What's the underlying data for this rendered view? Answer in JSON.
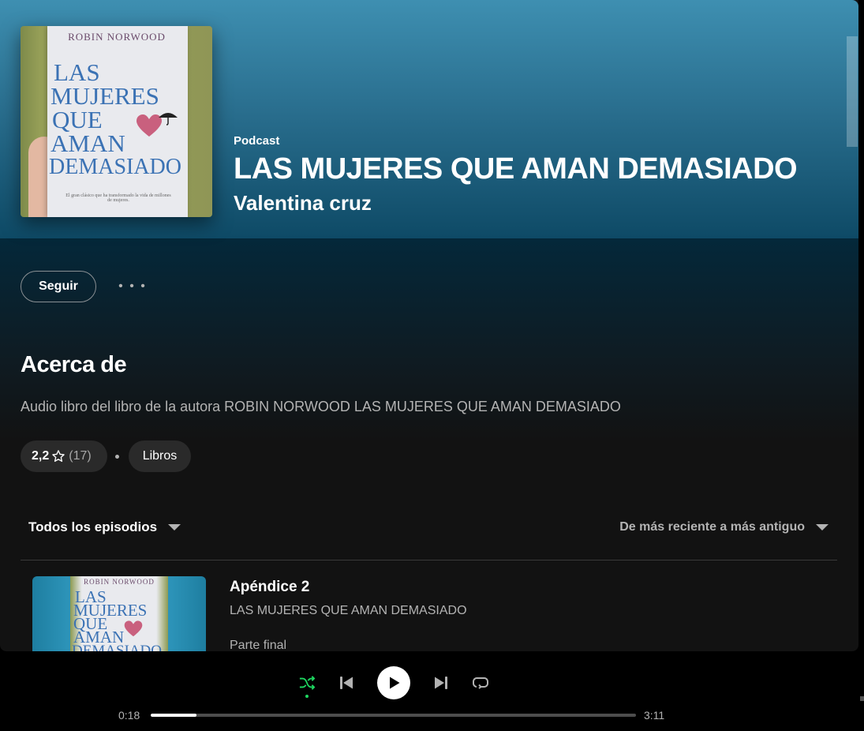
{
  "header": {
    "type_label": "Podcast",
    "title": "LAS MUJERES QUE AMAN DEMASIADO",
    "author": "Valentina cruz"
  },
  "cover": {
    "book_author": "ROBIN NORWOOD",
    "book_title_lines": [
      "LAS",
      "MUJERES",
      "QUE",
      "AMAN",
      "DEMASIADO"
    ],
    "tagline": "El gran clásico que ha transformado la vida de millones de mujeres."
  },
  "actions": {
    "follow_label": "Seguir",
    "more_label": "• • •"
  },
  "about": {
    "heading": "Acerca de",
    "description": "Audio libro del libro de la autora ROBIN NORWOOD LAS MUJERES QUE AMAN DEMASIADO",
    "rating_value": "2,2",
    "rating_count": "(17)",
    "category": "Libros"
  },
  "episodes": {
    "filter_label": "Todos los episodios",
    "sort_label": "De más reciente a más antiguo",
    "items": [
      {
        "title": "Apéndice 2",
        "show": "LAS MUJERES QUE AMAN DEMASIADO",
        "description": "Parte final",
        "thumb_author": "ROBIN NORWOOD",
        "thumb_lines": [
          "LAS",
          "MUJERES",
          "QUE",
          "AMAN",
          "DEMASIADO"
        ]
      }
    ]
  },
  "player": {
    "elapsed": "0:18",
    "total": "3:11",
    "progress_fraction": 0.094,
    "shuffle_active": true
  },
  "colors": {
    "accent_green": "#1ed760",
    "hero_top": "#3e8fb1",
    "hero_bottom": "#0e4a66",
    "background": "#121212"
  },
  "icons": [
    "shuffle-icon",
    "previous-icon",
    "play-icon",
    "next-icon",
    "repeat-icon",
    "star-icon",
    "chevron-down-icon",
    "heart-icon"
  ]
}
